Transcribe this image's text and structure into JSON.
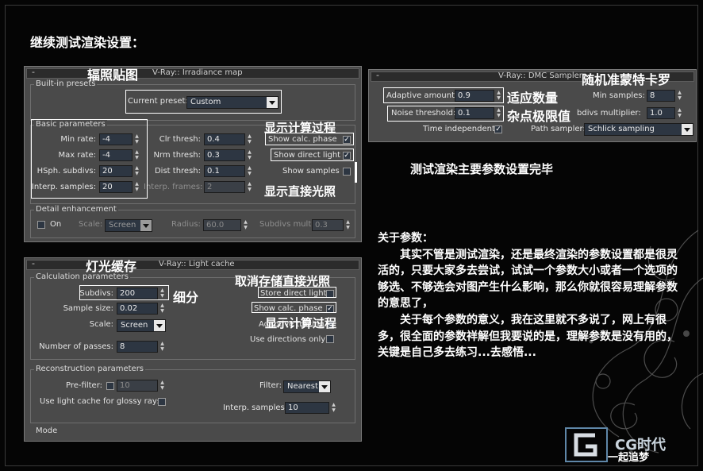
{
  "heading": "继续测试渲染设置：",
  "irradiance": {
    "cn_label": "辐照贴图",
    "title": "V-Ray:: Irradiance map",
    "minus": "-",
    "builtin": {
      "title": "Built-in presets",
      "current_preset_label": "Current preset:",
      "current_preset_value": "Custom"
    },
    "basic": {
      "title": "Basic parameters",
      "min_rate_label": "Min rate:",
      "min_rate": "-4",
      "max_rate_label": "Max rate:",
      "max_rate": "-4",
      "hsph_label": "HSph. subdivs:",
      "hsph": "20",
      "interp_label": "Interp. samples:",
      "interp": "20",
      "clr_label": "Clr thresh:",
      "clr": "0.4",
      "nrm_label": "Nrm thresh:",
      "nrm": "0.3",
      "dist_label": "Dist thresh:",
      "dist": "0.1",
      "frames_label": "Interp. frames:",
      "frames": "2",
      "show_calc_label": "Show calc. phase",
      "show_direct_label": "Show direct light",
      "show_samples_label": "Show samples"
    },
    "detail": {
      "title": "Detail enhancement",
      "on_label": "On",
      "scale_label": "Scale:",
      "scale_value": "Screen",
      "radius_label": "Radius:",
      "radius": "60.0",
      "subdivs_mult_label": "Subdivs mult.",
      "subdivs_mult": "0.3"
    }
  },
  "dmc": {
    "cn_label": "随机准蒙特卡罗",
    "title": "V-Ray:: DMC Sampler",
    "minus": "-",
    "adaptive_label": "Adaptive amount:",
    "adaptive": "0.9",
    "noise_label": "Noise threshold:",
    "noise": "0.1",
    "time_label": "Time independent",
    "min_samples_label": "Min samples:",
    "min_samples": "8",
    "subdivs_mult_label": "bdivs multiplier:",
    "subdivs_mult": "1.0",
    "path_label": "Path sampler:",
    "path_value": "Schlick sampling"
  },
  "lightcache": {
    "cn_label": "灯光缓存",
    "title": "V-Ray:: Light cache",
    "minus": "-",
    "calc": {
      "title": "Calculation parameters",
      "subdivs_label": "Subdivs:",
      "subdivs": "200",
      "sample_label": "Sample size:",
      "sample": "0.02",
      "scale_label": "Scale:",
      "scale_value": "Screen",
      "passes_label": "Number of passes:",
      "passes": "8",
      "store_label": "Store direct light",
      "show_calc_label": "Show calc. phase",
      "adaptive_label": "Adaptive tracing",
      "use_dir_label": "Use directions only"
    },
    "recon": {
      "title": "Reconstruction parameters",
      "prefilter_label": "Pre-filter:",
      "prefilter": "10",
      "glossy_label": "Use light cache for glossy rays",
      "filter_label": "Filter:",
      "filter_value": "Nearest",
      "interp_label": "Interp. samples:",
      "interp": "10"
    },
    "mode_title": "Mode"
  },
  "annotations": {
    "show_calc": "显示计算过程",
    "show_direct": "显示直接光照",
    "adaptive": "适应数量",
    "noise": "杂点极限值",
    "done": "测试渲染主要参数设置完毕",
    "subdivs": "细分",
    "cancel_store": "取消存储直接光照",
    "show_calc2": "显示计算过程"
  },
  "paragraph": {
    "title": "关于参数：",
    "p1": "　　其实不管是测试渲染，还是最终渲染的参数设置都是很灵活的，只要大家多去尝试，试试一个参数大小或者一个选项的够选、不够选会对图产生什么影响，那么你就很容易理解参数的意思了，",
    "p2": "　　关于每个参数的意义，我在这里就不多说了，网上有很多，很全面的参数祥解但我要说的是，理解参数是没有用的，关键是自己多去练习...去感悟..."
  },
  "watermark": {
    "brand": "CG时代",
    "slogan": "一起追梦"
  },
  "colors": {
    "background": "#050505",
    "panel": "#4a4a4a",
    "field": "#2d3642",
    "annotation": "#ffffff"
  }
}
